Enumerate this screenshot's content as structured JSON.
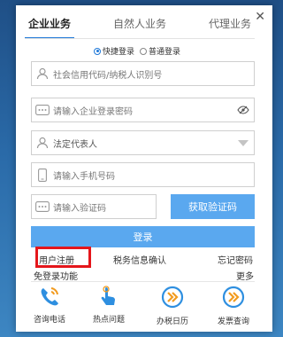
{
  "tabs": [
    "企业业务",
    "自然人业务",
    "代理业务"
  ],
  "login_modes": [
    {
      "label": "快捷登录",
      "selected": true
    },
    {
      "label": "普通登录",
      "selected": false
    }
  ],
  "fields": {
    "tax_id_placeholder": "社会信用代码/纳税人识别号",
    "password_placeholder": "请输入企业登录密码",
    "role_value": "法定代表人",
    "phone_placeholder": "请输入手机号码",
    "code_placeholder": "请输入验证码"
  },
  "buttons": {
    "get_code": "获取验证码",
    "login": "登录"
  },
  "links": {
    "register": "用户注册",
    "tax_confirm": "税务信息确认",
    "forgot": "忘记密码",
    "no_login": "免登录功能",
    "more": "更多"
  },
  "quick_items": [
    {
      "label": "咨询电话",
      "icon": "phone-icon"
    },
    {
      "label": "热点问题",
      "icon": "hand-pointer-icon"
    },
    {
      "label": "办税日历",
      "icon": "calendar-arrow-icon"
    },
    {
      "label": "发票查询",
      "icon": "invoice-arrow-icon"
    }
  ],
  "colors": {
    "accent": "#1e78d8",
    "button": "#5aa8ef",
    "highlight_box": "#e4161b",
    "icon_blue": "#2e8fe0",
    "icon_orange": "#f29b1f"
  }
}
